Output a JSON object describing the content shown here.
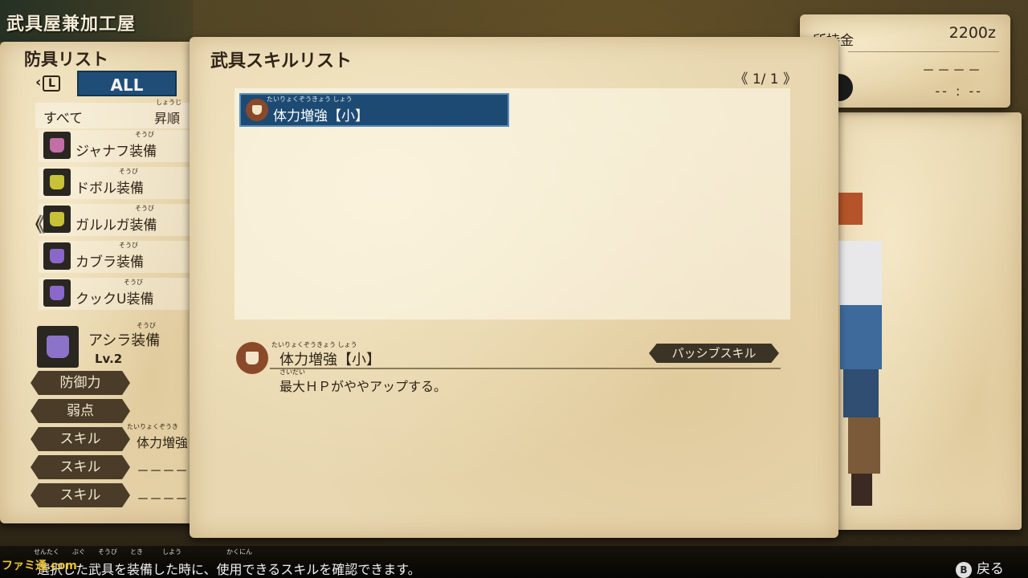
{
  "shop_title": "武具屋兼加工屋",
  "left_panel": {
    "title": "防具リスト",
    "filter": {
      "l_button": "L",
      "all_tab": "ALL"
    },
    "sort": {
      "left": "すべて",
      "right": "昇順",
      "right_ruby": "しょうじ"
    },
    "items": [
      {
        "name": "ジャナフ装備",
        "ruby": "そうび",
        "color": "#c26fa7"
      },
      {
        "name": "ドボル装備",
        "ruby": "そうび",
        "color": "#c7c237"
      },
      {
        "name": "ガルルガ装備",
        "ruby": "そうび",
        "color": "#c7c237"
      },
      {
        "name": "カブラ装備",
        "ruby": "そうび",
        "color": "#8a68c9"
      },
      {
        "name": "クックU装備",
        "ruby": "そうび",
        "color": "#8a68c9"
      }
    ],
    "equip": {
      "name": "アシラ装備",
      "ruby": "そうび",
      "level": "Lv.2"
    },
    "stats": [
      {
        "tag": "防御力",
        "value": "",
        "ruby": ""
      },
      {
        "tag": "弱点",
        "value": "",
        "ruby": ""
      },
      {
        "tag": "スキル",
        "value": "体力増強",
        "ruby": "たいりょくぞうき"
      },
      {
        "tag": "スキル",
        "value": "－－－－",
        "ruby": ""
      },
      {
        "tag": "スキル",
        "value": "－－－－",
        "ruby": ""
      }
    ]
  },
  "money": {
    "label": "所持金",
    "amount": "2200z",
    "line1": "－－－－",
    "line2": "-- : --"
  },
  "dialog": {
    "title": "武具スキルリスト",
    "pager": "《  1/  1 》",
    "skills": [
      {
        "name": "体力増強【小】",
        "ruby": "たいりょくぞうきょう しょう"
      }
    ],
    "detail": {
      "name": "体力増強【小】",
      "ruby": "たいりょくぞうきょう しょう",
      "badge": "パッシブスキル",
      "desc": "最大ＨＰがややアップする。",
      "desc_ruby": "さいだい"
    }
  },
  "bottom": {
    "help": "選択した武具を装備した時に、使用できるスキルを確認できます。",
    "help_ruby": "せんたく　　ぶぐ　　そうび　　とき　　　しよう　　　　　　　かくにん",
    "back_key": "B",
    "back": "戻る"
  },
  "watermark": "ファミ通.com"
}
